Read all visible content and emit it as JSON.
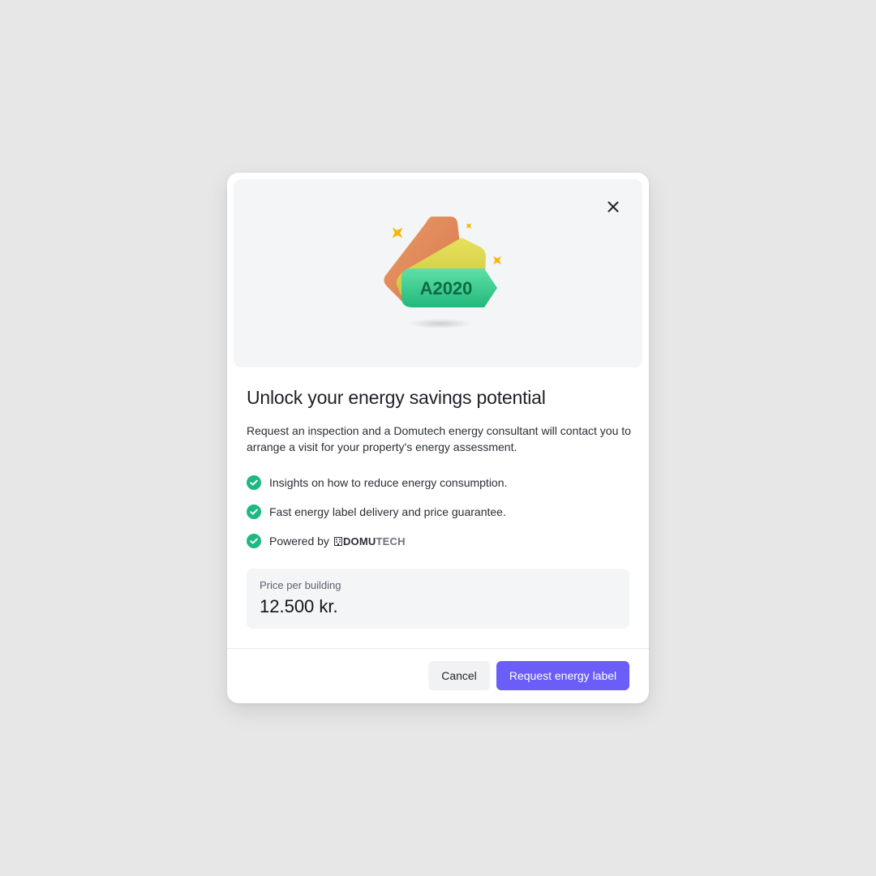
{
  "modal": {
    "illustration": {
      "label_text": "A2020",
      "colors": {
        "orange": "#e08a5c",
        "yellow": "#d8d24f",
        "green": "#2fc98b",
        "sparkle": "#f5b800"
      }
    },
    "close_icon": "close-icon",
    "title": "Unlock your energy savings potential",
    "description": "Request an inspection and a Domutech energy consultant will contact you to arrange a visit for your property's energy assessment.",
    "features": [
      {
        "icon": "check-circle-icon",
        "text": "Insights on how to reduce energy consumption."
      },
      {
        "icon": "check-circle-icon",
        "text": "Fast energy label delivery and price guarantee."
      },
      {
        "icon": "check-circle-icon",
        "text": "Powered by"
      }
    ],
    "brand": {
      "part1": "DOMU",
      "part2": "TECH"
    },
    "price": {
      "label": "Price per building",
      "value": "12.500 kr."
    },
    "buttons": {
      "cancel": "Cancel",
      "primary": "Request energy label"
    },
    "colors": {
      "accent": "#6b5ef8",
      "check": "#1eb980"
    }
  }
}
